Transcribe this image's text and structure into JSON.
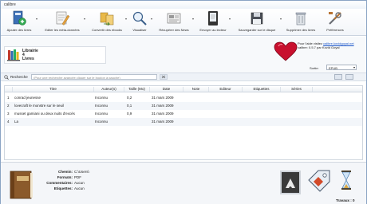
{
  "window": {
    "title": "calibre"
  },
  "toolbar": {
    "buttons": [
      {
        "label": "Ajouter des livres",
        "icon": "add-books-icon"
      },
      {
        "label": "Editer les méta-données",
        "icon": "edit-metadata-icon"
      },
      {
        "label": "Convertir des ebooks",
        "icon": "convert-icon"
      },
      {
        "label": "Visualiser",
        "icon": "view-icon"
      },
      {
        "label": "Récupérer des News",
        "icon": "fetch-news-icon"
      },
      {
        "label": "Envoyer au lecteur",
        "icon": "send-to-device-icon"
      },
      {
        "label": "Sauvegarder sur le disque",
        "icon": "save-to-disk-icon"
      },
      {
        "label": "Supprimer des livres",
        "icon": "delete-icon"
      },
      {
        "label": "Préférences",
        "icon": "preferences-icon"
      }
    ]
  },
  "library": {
    "name": "Librairie",
    "count": "4",
    "unit": "Livres"
  },
  "info": {
    "line1_prefix": "Pour l'aide visitez ",
    "link": "calibre.kovidgoyal.net",
    "line2": "calibre: 0.5.7 par Kovid Goyal"
  },
  "sort": {
    "label": "Sortie:",
    "value": "EPUB"
  },
  "search": {
    "label": "Recherche",
    "placeholder": "(Pour une recherche avancée cliquer sur le bouton à gauche)"
  },
  "table": {
    "columns": [
      "Titre",
      "Auteur(s)",
      "Taille (Mo)",
      "Date",
      "Note",
      "Editeur",
      "Etiquettes",
      "Séries"
    ],
    "rows": [
      {
        "num": "1",
        "title": "conrad jeunesse",
        "author": "Inconnu",
        "size": "0,2",
        "date": "31 mars 2009"
      },
      {
        "num": "2",
        "title": "lovecraft le monstre sur le seuil",
        "author": "Inconnu",
        "size": "0,1",
        "date": "31 mars 2009"
      },
      {
        "num": "3",
        "title": "musset gamiani ou deux nuits d'excès",
        "author": "Inconnu",
        "size": "0,9",
        "date": "31 mars 2009"
      },
      {
        "num": "4",
        "title": "La",
        "author": "Inconnu",
        "size": "",
        "date": "31 mars 2009"
      }
    ]
  },
  "details": {
    "labels": [
      "Chemin:",
      "Formats:",
      "Commentaires:",
      "Etiquettes:"
    ],
    "values": [
      "C:\\Users\\",
      "PDF",
      "Aucun",
      "Aucun"
    ]
  },
  "jobs": {
    "label": "Travaux : 0"
  },
  "colors": {
    "accent": "#1a55c9",
    "heart": "#c8102e",
    "header_bg": "#edf1f5"
  }
}
